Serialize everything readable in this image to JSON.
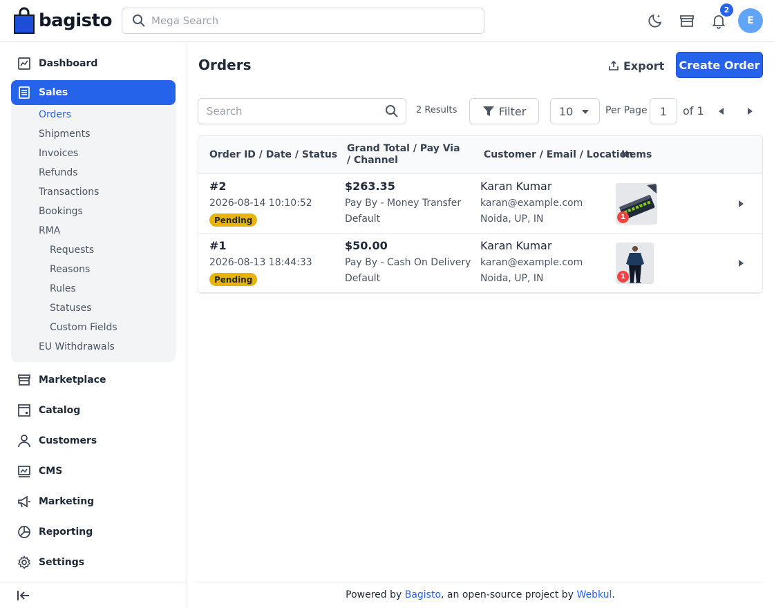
{
  "header": {
    "logo_text": "bagisto",
    "search_placeholder": "Mega Search",
    "notification_count": "2",
    "avatar_initial": "E"
  },
  "sidebar": {
    "items": [
      {
        "label": "Dashboard",
        "icon": "dashboard-icon"
      },
      {
        "label": "Sales",
        "icon": "sales-icon",
        "active": true
      },
      {
        "label": "Marketplace",
        "icon": "store-icon"
      },
      {
        "label": "Catalog",
        "icon": "catalog-icon"
      },
      {
        "label": "Customers",
        "icon": "customers-icon"
      },
      {
        "label": "CMS",
        "icon": "cms-icon"
      },
      {
        "label": "Marketing",
        "icon": "megaphone-icon"
      },
      {
        "label": "Reporting",
        "icon": "pie-chart-icon"
      },
      {
        "label": "Settings",
        "icon": "gear-icon"
      }
    ],
    "sales_sub": [
      "Orders",
      "Shipments",
      "Invoices",
      "Refunds",
      "Transactions",
      "Bookings",
      "RMA"
    ],
    "rma_sub": [
      "Requests",
      "Reasons",
      "Rules",
      "Statuses",
      "Custom Fields"
    ],
    "eu_withdrawals": "EU Withdrawals"
  },
  "page": {
    "title": "Orders",
    "export_label": "Export",
    "create_label": "Create Order"
  },
  "toolbar": {
    "search_placeholder": "Search",
    "results": "2 Results",
    "filter_label": "Filter",
    "per_page_value": "10",
    "per_page_label": "Per Page",
    "page_number": "1",
    "page_of": "of 1"
  },
  "table": {
    "headers": [
      "Order ID / Date / Status",
      "Grand Total / Pay Via / Channel",
      "Customer / Email / Location",
      "Items"
    ],
    "rows": [
      {
        "id": "#2",
        "date": "2026-08-14 10:10:52",
        "status": "Pending",
        "total": "$263.35",
        "pay_via": "Pay By - Money Transfer",
        "channel": "Default",
        "customer": "Karan Kumar",
        "email": "karan@example.com",
        "location": "Noida, UP, IN",
        "item_qty": "1",
        "item_icon": "network-switch-thumbnail"
      },
      {
        "id": "#1",
        "date": "2026-08-13 18:44:33",
        "status": "Pending",
        "total": "$50.00",
        "pay_via": "Pay By - Cash On Delivery",
        "channel": "Default",
        "customer": "Karan Kumar",
        "email": "karan@example.com",
        "location": "Noida, UP, IN",
        "item_qty": "1",
        "item_icon": "man-in-outfit-thumbnail"
      }
    ]
  },
  "footer": {
    "prefix": "Powered by ",
    "brand": "Bagisto",
    "middle": ", an open-source project by ",
    "company": "Webkul",
    "suffix": "."
  },
  "colors": {
    "accent": "#2563eb",
    "pending": "#eab308",
    "badge_red": "#ef4444"
  }
}
